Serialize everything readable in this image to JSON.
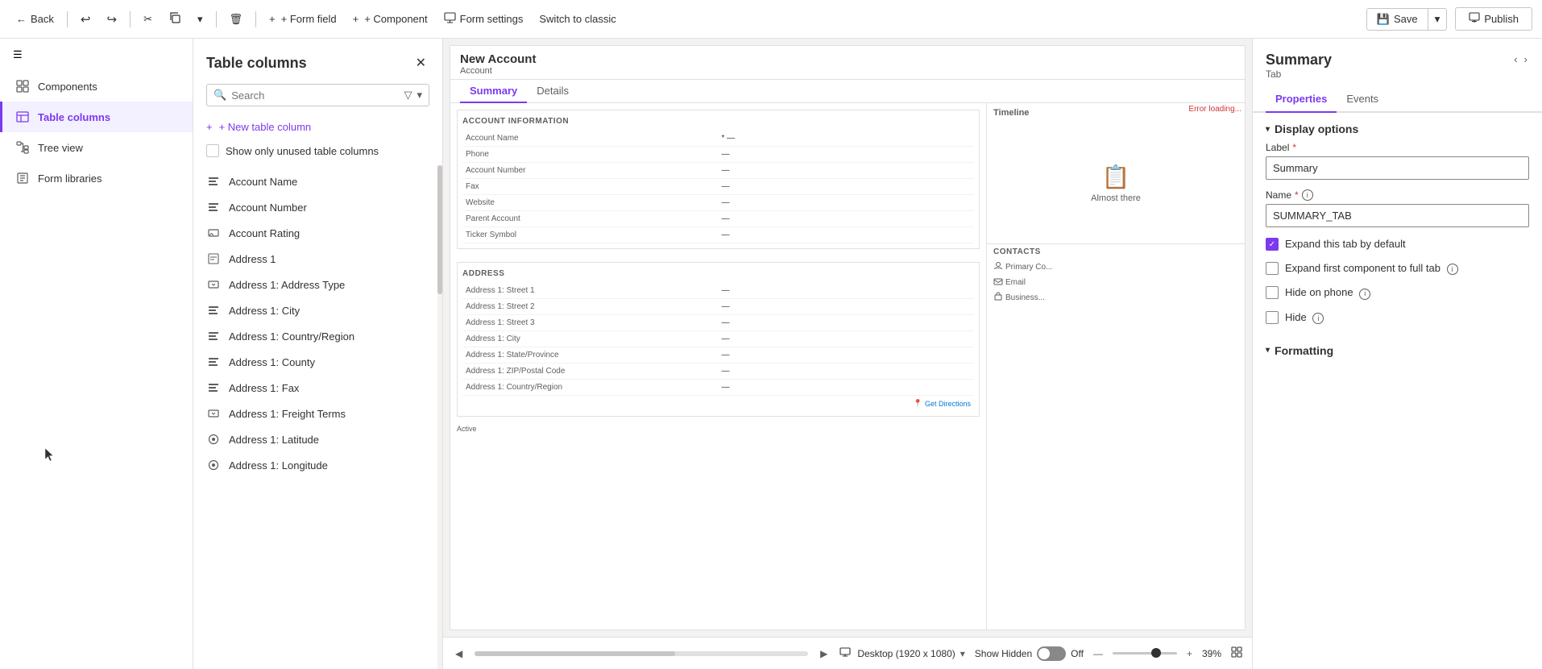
{
  "toolbar": {
    "back_label": "Back",
    "undo_icon": "↩",
    "redo_icon": "↪",
    "cut_icon": "✂",
    "copy_dropdown_icon": "▾",
    "delete_icon": "🗑",
    "add_field_label": "+ Form field",
    "add_component_label": "+ Component",
    "form_settings_label": "Form settings",
    "switch_classic_label": "Switch to classic",
    "save_label": "Save",
    "save_dropdown_icon": "▾",
    "publish_label": "Publish"
  },
  "sidebar": {
    "hamburger_icon": "☰",
    "items": [
      {
        "id": "components",
        "label": "Components",
        "icon": "grid"
      },
      {
        "id": "table-columns",
        "label": "Table columns",
        "icon": "table",
        "active": true
      },
      {
        "id": "tree-view",
        "label": "Tree view",
        "icon": "tree"
      },
      {
        "id": "form-libraries",
        "label": "Form libraries",
        "icon": "library"
      }
    ]
  },
  "columns_panel": {
    "title": "Table columns",
    "close_icon": "✕",
    "search_placeholder": "Search",
    "search_icon": "🔍",
    "filter_icon": "▽",
    "filter_dropdown_icon": "▾",
    "new_column_label": "+ New table column",
    "show_unused_label": "Show only unused table columns",
    "columns": [
      {
        "label": "Account Name",
        "icon": "text"
      },
      {
        "label": "Account Number",
        "icon": "text"
      },
      {
        "label": "Account Rating",
        "icon": "select"
      },
      {
        "label": "Address 1",
        "icon": "text-multiline"
      },
      {
        "label": "Address 1: Address Type",
        "icon": "select"
      },
      {
        "label": "Address 1: City",
        "icon": "text"
      },
      {
        "label": "Address 1: Country/Region",
        "icon": "text"
      },
      {
        "label": "Address 1: County",
        "icon": "text"
      },
      {
        "label": "Address 1: Fax",
        "icon": "text"
      },
      {
        "label": "Address 1: Freight Terms",
        "icon": "select"
      },
      {
        "label": "Address 1: Latitude",
        "icon": "number"
      },
      {
        "label": "Address 1: Longitude",
        "icon": "number"
      }
    ]
  },
  "form_preview": {
    "title": "New Account",
    "subtitle": "Account",
    "tabs": [
      "Summary",
      "Details"
    ],
    "active_tab": "Summary",
    "sections": {
      "account_info": {
        "title": "ACCOUNT INFORMATION",
        "fields": [
          {
            "label": "Account Name",
            "value": "*  —"
          },
          {
            "label": "Phone",
            "value": "—"
          },
          {
            "label": "Account Number",
            "value": "—"
          },
          {
            "label": "Fax",
            "value": "—"
          },
          {
            "label": "Website",
            "value": "—"
          },
          {
            "label": "Parent Account",
            "value": "—"
          },
          {
            "label": "Ticker Symbol",
            "value": "—"
          }
        ]
      },
      "address": {
        "title": "ADDRESS",
        "fields": [
          {
            "label": "Address 1: Street 1",
            "value": "—"
          },
          {
            "label": "Address 1: Street 2",
            "value": "—"
          },
          {
            "label": "Address 1: Street 3",
            "value": "—"
          },
          {
            "label": "Address 1: City",
            "value": "—"
          },
          {
            "label": "Address 1: State/Province",
            "value": "—"
          },
          {
            "label": "Address 1: ZIP/Postal Code",
            "value": "—"
          },
          {
            "label": "Address 1: Country/Region",
            "value": "—"
          }
        ]
      },
      "get_directions": "Get Directions"
    },
    "timeline_label": "Timeline",
    "timeline_empty_icon": "📋",
    "timeline_empty_text": "Almost there",
    "error_loading": "Error loading...",
    "contacts_label": "CONTACTS",
    "primary_col_label": "Primary Co...",
    "email_label": "Email",
    "business_label": "Business...",
    "status_label": "Active"
  },
  "bottom_bar": {
    "desktop_label": "Desktop (1920 x 1080)",
    "dropdown_icon": "▾",
    "show_hidden_label": "Show Hidden",
    "toggle_state": "Off",
    "zoom_minus": "—",
    "zoom_plus": "+",
    "zoom_level": "39%",
    "fit_icon": "⊡"
  },
  "right_panel": {
    "title": "Summary",
    "subtitle": "Tab",
    "nav_prev": "‹",
    "nav_next": "›",
    "tabs": [
      "Properties",
      "Events"
    ],
    "active_tab": "Properties",
    "display_options": {
      "section_title": "Display options",
      "label_label": "Label",
      "label_required": true,
      "label_value": "Summary",
      "name_label": "Name",
      "name_required": true,
      "name_info": "ℹ",
      "name_value": "SUMMARY_TAB",
      "expand_tab_label": "Expand this tab by default",
      "expand_tab_checked": true,
      "expand_first_label": "Expand first component to full tab",
      "expand_first_checked": false,
      "expand_first_info": true,
      "hide_phone_label": "Hide on phone",
      "hide_phone_checked": false,
      "hide_phone_info": true,
      "hide_label": "Hide",
      "hide_checked": false,
      "hide_info": true
    },
    "formatting": {
      "section_title": "Formatting"
    }
  }
}
